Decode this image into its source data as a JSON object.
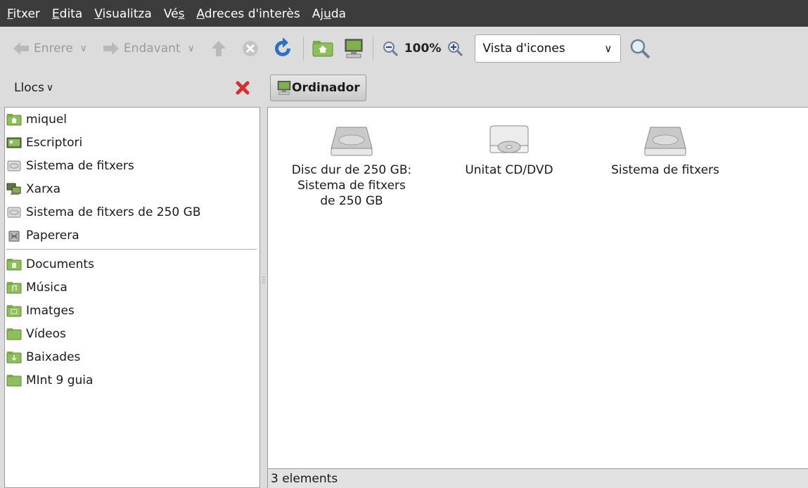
{
  "menubar": {
    "items": [
      {
        "mn": "F",
        "rest": "itxer"
      },
      {
        "mn": "E",
        "rest": "dita"
      },
      {
        "mn": "V",
        "rest": "isualitza"
      },
      {
        "pre": "Vé",
        "mn": "s",
        "rest": ""
      },
      {
        "mn": "A",
        "rest": "dreces d'interès"
      },
      {
        "pre": "Aj",
        "mn": "u",
        "rest": "da"
      }
    ]
  },
  "toolbar": {
    "back_label": "Enrere",
    "forward_label": "Endavant",
    "zoom_level": "100%",
    "view_mode": "Vista d'icones"
  },
  "sidebar": {
    "header_label": "Llocs",
    "places": [
      {
        "label": "miquel",
        "icon": "home-folder-icon"
      },
      {
        "label": "Escriptori",
        "icon": "desktop-icon"
      },
      {
        "label": "Sistema de fitxers",
        "icon": "filesystem-icon"
      },
      {
        "label": "Xarxa",
        "icon": "network-icon"
      },
      {
        "label": "Sistema de fitxers de 250 GB",
        "icon": "drive-icon"
      },
      {
        "label": "Paperera",
        "icon": "trash-icon"
      }
    ],
    "bookmarks": [
      {
        "label": "Documents",
        "icon": "documents-folder-icon"
      },
      {
        "label": "Música",
        "icon": "music-folder-icon"
      },
      {
        "label": "Imatges",
        "icon": "pictures-folder-icon"
      },
      {
        "label": "Vídeos",
        "icon": "videos-folder-icon"
      },
      {
        "label": "Baixades",
        "icon": "downloads-folder-icon"
      },
      {
        "label": "MInt 9 guia",
        "icon": "folder-icon"
      }
    ]
  },
  "pathbar": {
    "location": "Ordinador"
  },
  "content": {
    "items": [
      {
        "line1": "Disc dur de 250 GB:",
        "line2": "Sistema de fitxers",
        "line3": "de 250 GB",
        "icon": "hard-disk-icon"
      },
      {
        "line1": "Unitat CD/DVD",
        "line2": "",
        "line3": "",
        "icon": "optical-drive-icon"
      },
      {
        "line1": "Sistema de fitxers",
        "line2": "",
        "line3": "",
        "icon": "hard-disk-icon"
      }
    ]
  },
  "statusbar": {
    "text": "3 elements"
  },
  "colors": {
    "menubar_bg": "#3c3c3c",
    "window_bg": "#dcdcdc",
    "folder_green": "#8fbf5a",
    "close_red": "#d43030",
    "reload_blue": "#2d6fc4"
  }
}
